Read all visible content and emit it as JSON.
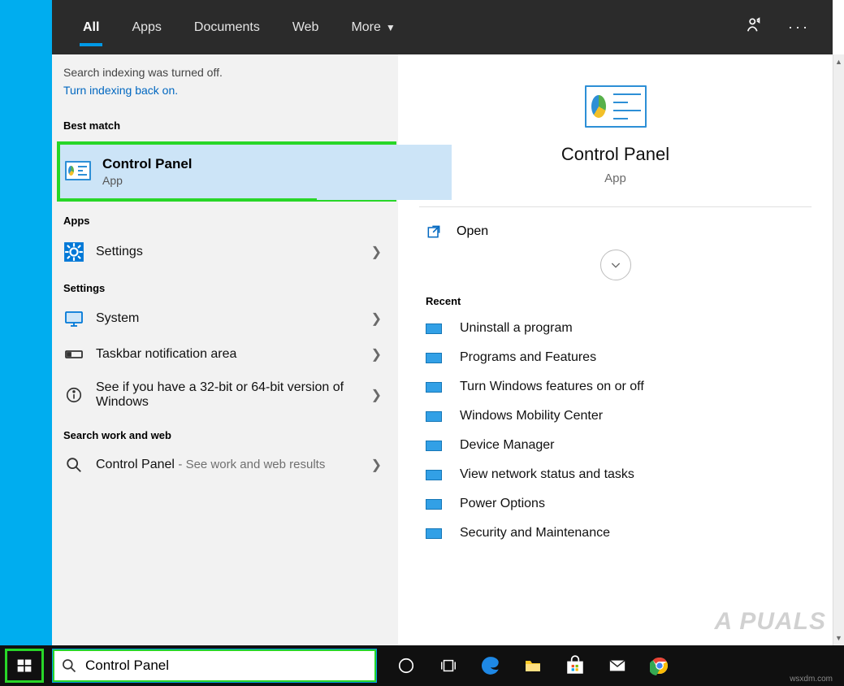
{
  "nav": {
    "tabs": {
      "all": "All",
      "apps": "Apps",
      "documents": "Documents",
      "web": "Web",
      "more": "More"
    }
  },
  "indexing": {
    "status": "Search indexing was turned off.",
    "link": "Turn indexing back on."
  },
  "sections": {
    "best_match": "Best match",
    "apps": "Apps",
    "settings": "Settings",
    "search_work_web": "Search work and web"
  },
  "best_match": {
    "title": "Control Panel",
    "subtitle": "App"
  },
  "apps_list": [
    {
      "label": "Settings"
    }
  ],
  "settings_list": [
    {
      "label": "System"
    },
    {
      "label": "Taskbar notification area"
    },
    {
      "label": "See if you have a 32-bit or 64-bit version of Windows"
    }
  ],
  "workweb": {
    "label": "Control Panel",
    "suffix": "- See work and web results"
  },
  "detail": {
    "title": "Control Panel",
    "subtitle": "App",
    "open": "Open",
    "recent_label": "Recent",
    "recent": [
      "Uninstall a program",
      "Programs and Features",
      "Turn Windows features on or off",
      "Windows Mobility Center",
      "Device Manager",
      "View network status and tasks",
      "Power Options",
      "Security and Maintenance"
    ]
  },
  "searchbox": {
    "value": "Control Panel"
  },
  "watermark": "A  PUALS",
  "wsx": "wsxdm.com"
}
